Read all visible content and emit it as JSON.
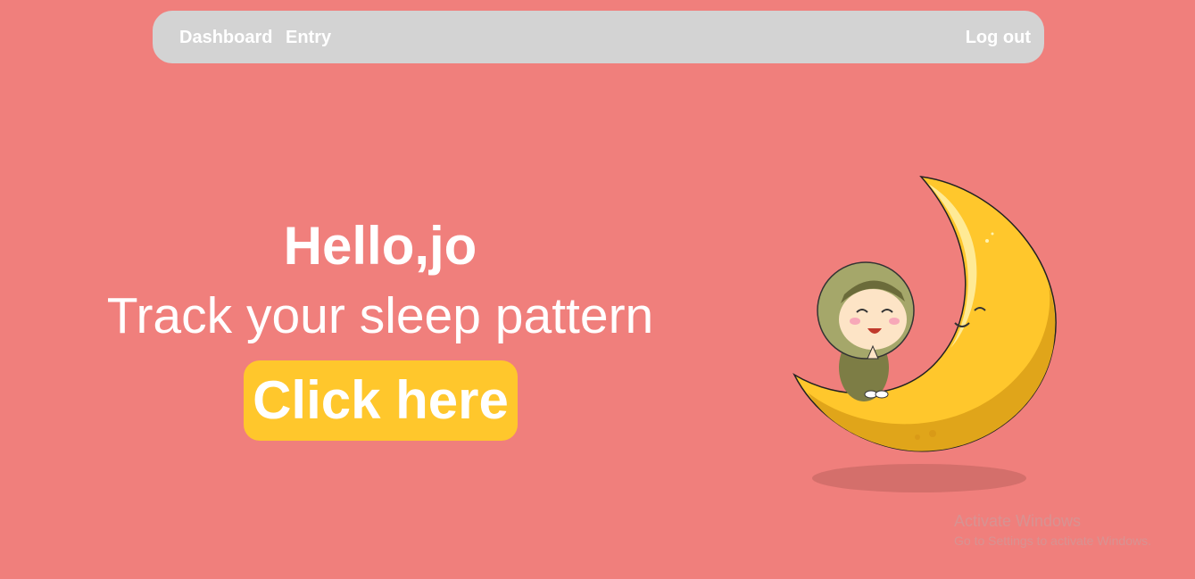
{
  "navbar": {
    "links": [
      "Dashboard",
      "Entry"
    ],
    "logout_label": "Log out"
  },
  "hero": {
    "greeting": "Hello,jo",
    "tagline": "Track your sleep pattern",
    "cta_label": "Click here"
  },
  "illustration": {
    "name": "girl-on-crescent-moon-illustration",
    "colors": {
      "moon": "#ffc72c",
      "moon_shade": "#e7ad1c",
      "hijab": "#a5a76a",
      "skin": "#fde4c6"
    }
  },
  "watermark": {
    "title": "Activate Windows",
    "subtitle": "Go to Settings to activate Windows."
  },
  "colors": {
    "background": "#f07f7c",
    "navbar": "#d3d3d3",
    "cta": "#ffc72c",
    "text": "#ffffff"
  }
}
